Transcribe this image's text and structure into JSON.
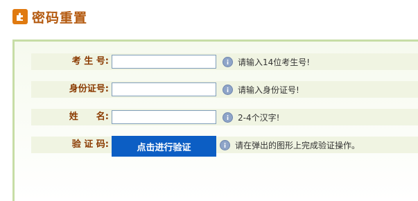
{
  "header": {
    "title": "密码重置",
    "icon": "puzzle-icon"
  },
  "form": {
    "rows": [
      {
        "label": "考 生 号:",
        "value": "",
        "hint": "请输入14位考生号!"
      },
      {
        "label": "身份证号:",
        "value": "",
        "hint": "请输入身份证号!"
      },
      {
        "label": "姓　　名:",
        "value": "",
        "hint": "2-4个汉字!"
      },
      {
        "label": "验 证 码:",
        "button": "点击进行验证",
        "hint": "请在弹出的图形上完成验证操作。"
      }
    ]
  },
  "colors": {
    "accent": "#b45a10",
    "button": "#0c5ec4",
    "label": "#8a3a00"
  }
}
